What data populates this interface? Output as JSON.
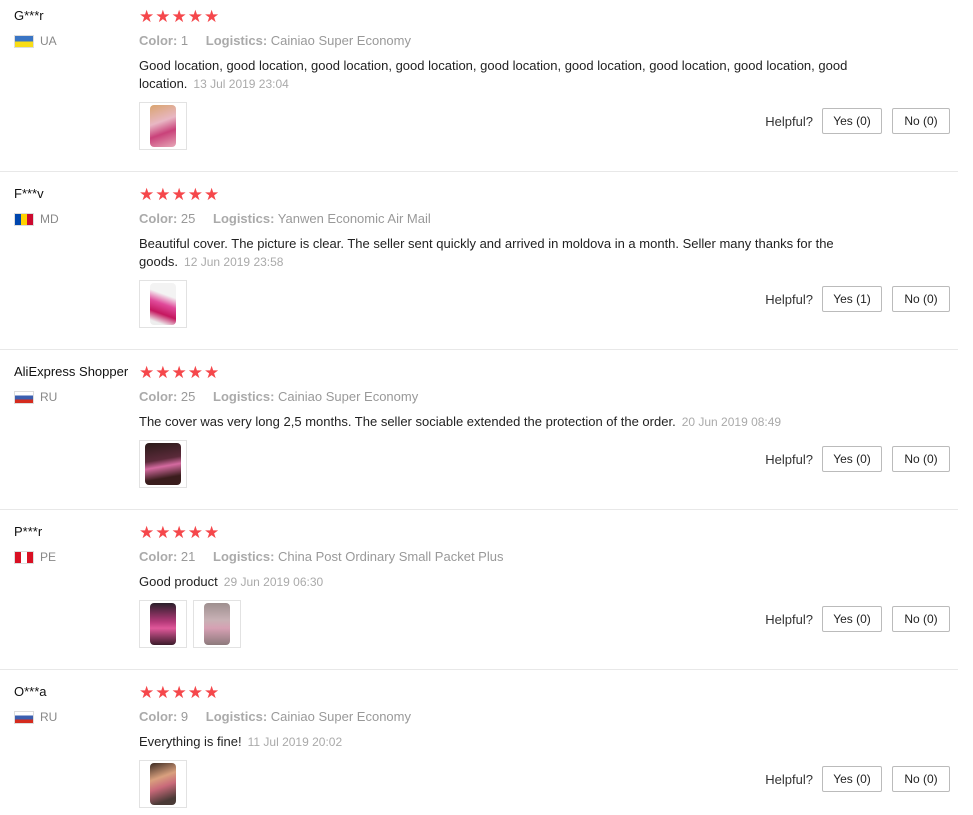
{
  "labels": {
    "color": "Color:",
    "logistics": "Logistics:",
    "helpful": "Helpful?"
  },
  "star_color": "#f5474b",
  "reviews": [
    {
      "user": "G***r",
      "country": "UA",
      "rating": 5,
      "stars": "★★★★★",
      "color_value": "1",
      "logistics_value": "Cainiao Super Economy",
      "text": "Good location, good location, good location, good location, good location, good location, good location, good location, good location.",
      "date": "13 Jul 2019 23:04",
      "yes": "Yes (0)",
      "no": "No (0)"
    },
    {
      "user": "F***v",
      "country": "MD",
      "rating": 5,
      "stars": "★★★★★",
      "color_value": "25",
      "logistics_value": "Yanwen Economic Air Mail",
      "text": "Beautiful cover. The picture is clear. The seller sent quickly and arrived in moldova in a month. Seller many thanks for the goods.",
      "date": "12 Jun 2019 23:58",
      "yes": "Yes (1)",
      "no": "No (0)"
    },
    {
      "user": "AliExpress Shopper",
      "country": "RU",
      "rating": 5,
      "stars": "★★★★★",
      "color_value": "25",
      "logistics_value": "Cainiao Super Economy",
      "text": "The cover was very long 2,5 months. The seller sociable extended the protection of the order.",
      "date": "20 Jun 2019 08:49",
      "yes": "Yes (0)",
      "no": "No (0)"
    },
    {
      "user": "P***r",
      "country": "PE",
      "rating": 5,
      "stars": "★★★★★",
      "color_value": "21",
      "logistics_value": "China Post Ordinary Small Packet Plus",
      "text": "Good product",
      "date": "29 Jun 2019 06:30",
      "yes": "Yes (0)",
      "no": "No (0)"
    },
    {
      "user": "O***a",
      "country": "RU",
      "rating": 5,
      "stars": "★★★★★",
      "color_value": "9",
      "logistics_value": "Cainiao Super Economy",
      "text": "Everything is fine!",
      "date": "11 Jul 2019 20:02",
      "yes": "Yes (0)",
      "no": "No (0)"
    }
  ]
}
